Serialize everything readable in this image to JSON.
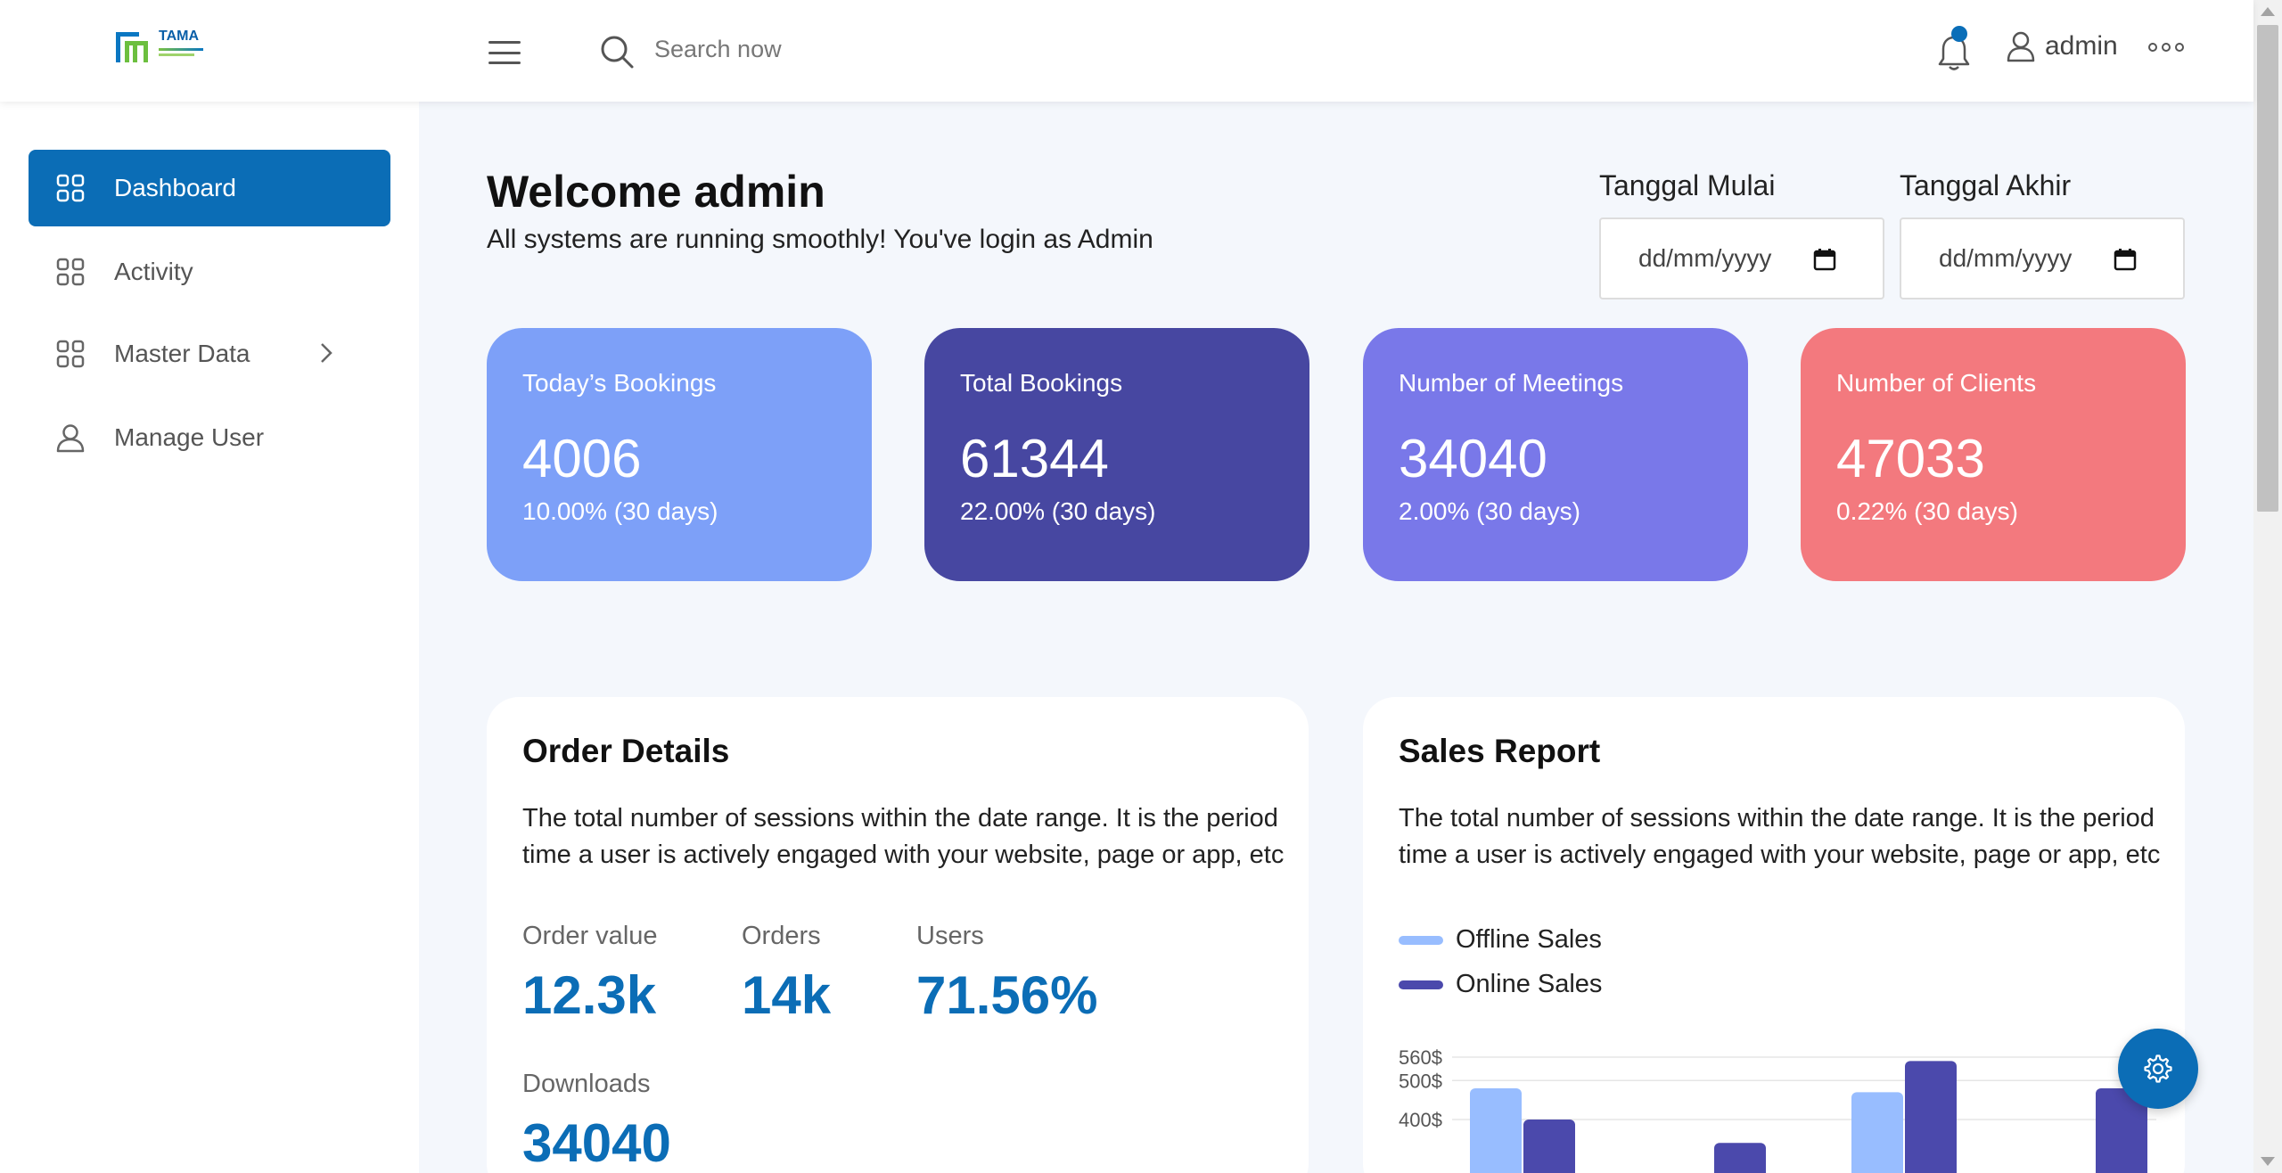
{
  "header": {
    "logo_text": "TAMA",
    "search_placeholder": "Search now",
    "user_name": "admin"
  },
  "sidebar": {
    "items": [
      {
        "label": "Dashboard",
        "active": true,
        "icon": "grid-icon"
      },
      {
        "label": "Activity",
        "active": false,
        "icon": "grid-icon"
      },
      {
        "label": "Master Data",
        "active": false,
        "icon": "grid-icon"
      },
      {
        "label": "Manage User",
        "active": false,
        "icon": "user-icon"
      }
    ]
  },
  "welcome": {
    "title": "Welcome admin",
    "subtitle": "All systems are running smoothly! You've login as Admin"
  },
  "date_filter": {
    "start_label": "Tanggal Mulai",
    "end_label": "Tanggal Akhir",
    "start_placeholder": "dd/mm/yyyy",
    "end_placeholder": "dd/mm/yyyy"
  },
  "stats": [
    {
      "title": "Today’s Bookings",
      "value": "4006",
      "sub": "10.00% (30 days)",
      "color": "#7da0f8"
    },
    {
      "title": "Total Bookings",
      "value": "61344",
      "sub": "22.00% (30 days)",
      "color": "#4747a1"
    },
    {
      "title": "Number of Meetings",
      "value": "34040",
      "sub": "2.00% (30 days)",
      "color": "#7978e9"
    },
    {
      "title": "Number of Clients",
      "value": "47033",
      "sub": "0.22% (30 days)",
      "color": "#f3797e"
    }
  ],
  "order_details": {
    "title": "Order Details",
    "description": "The total number of sessions within the date range. It is the period time a user is actively engaged with your website, page or app, etc",
    "metrics": [
      {
        "label": "Order value",
        "value": "12.3k"
      },
      {
        "label": "Orders",
        "value": "14k"
      },
      {
        "label": "Users",
        "value": "71.56%"
      },
      {
        "label": "Downloads",
        "value": "34040"
      }
    ]
  },
  "sales_report": {
    "title": "Sales Report",
    "description": "The total number of sessions within the date range. It is the period time a user is actively engaged with your website, page or app, etc",
    "legend": [
      {
        "name": "Offline Sales",
        "color": "#98bdff"
      },
      {
        "name": "Online Sales",
        "color": "#4b49ac"
      }
    ]
  },
  "chart_data": {
    "type": "bar",
    "categories": [
      "",
      "",
      "",
      "",
      ""
    ],
    "series": [
      {
        "name": "Offline Sales",
        "values": [
          480,
          null,
          470,
          null,
          null
        ]
      },
      {
        "name": "Online Sales",
        "values": [
          400,
          340,
          550,
          480,
          null
        ]
      }
    ],
    "ytick_labels": [
      "560$",
      "500$",
      "400$"
    ],
    "yticks": [
      560,
      500,
      400
    ],
    "ylim": [
      300,
      560
    ]
  },
  "colors": {
    "primary": "#0b6db6",
    "background": "#f4f7fc"
  }
}
